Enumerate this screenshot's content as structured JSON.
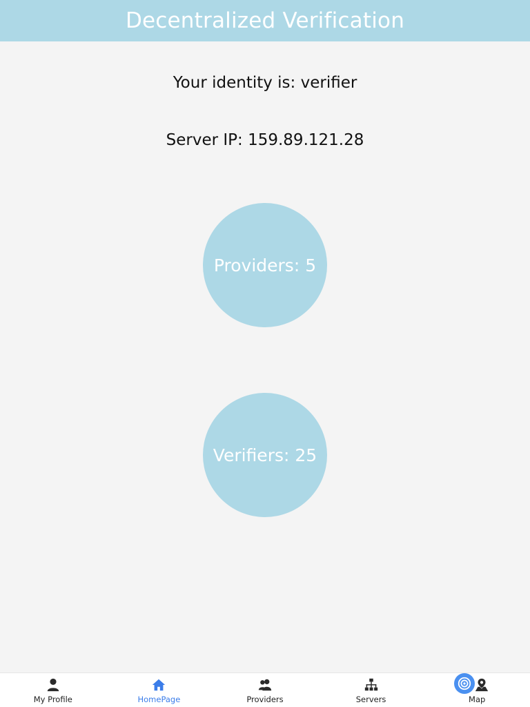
{
  "header": {
    "title": "Decentralized Verification"
  },
  "identity_text": "Your identity is: verifier",
  "server_text": "Server IP: 159.89.121.28",
  "stats": {
    "providers": "Providers: 5",
    "verifiers": "Verifiers: 25"
  },
  "colors": {
    "accent": "#add8e6",
    "active_tab": "#3b7de9",
    "badge": "#4a90f0"
  },
  "tabs": [
    {
      "label": "My Profile",
      "icon": "person-icon"
    },
    {
      "label": "HomePage",
      "icon": "home-icon",
      "active": true
    },
    {
      "label": "Providers",
      "icon": "people-icon"
    },
    {
      "label": "Servers",
      "icon": "network-icon"
    },
    {
      "label": "Map",
      "icon": "map-pin-icon"
    }
  ]
}
